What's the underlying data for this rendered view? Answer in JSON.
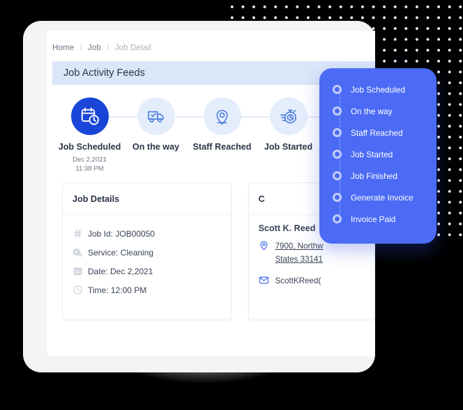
{
  "breadcrumb": {
    "items": [
      "Home",
      "Job",
      "Job Detail"
    ],
    "separator": "/"
  },
  "feed_header": {
    "title": "Job Activity Feeds"
  },
  "stepper": {
    "steps": [
      {
        "label": "Job Scheduled",
        "icon": "calendar-clock-icon",
        "active": true,
        "date": "Dec 2,2021",
        "time": "11:38 PM"
      },
      {
        "label": "On the way",
        "icon": "truck-check-icon",
        "active": false,
        "date": "",
        "time": ""
      },
      {
        "label": "Staff Reached",
        "icon": "map-pin-icon",
        "active": false,
        "date": "",
        "time": ""
      },
      {
        "label": "Job Started",
        "icon": "stopwatch-icon",
        "active": false,
        "date": "",
        "time": ""
      }
    ]
  },
  "job_details": {
    "title": "Job Details",
    "rows": [
      {
        "icon": "hash-icon",
        "text": "Job Id: JOB00050"
      },
      {
        "icon": "gears-icon",
        "text": "Service: Cleaning"
      },
      {
        "icon": "calendar-icon",
        "text": "Date: Dec 2,2021"
      },
      {
        "icon": "clock-icon",
        "text": "Time: 12:00 PM"
      }
    ]
  },
  "customer_details": {
    "title": "C",
    "name": "Scott K. Reed",
    "address_line1": "7900, Northw",
    "address_line2": "States 33141",
    "email": "ScottKReed("
  },
  "dropdown": {
    "items": [
      "Job Scheduled",
      "On the way",
      "Staff Reached",
      "Job Started",
      "Job Finished",
      "Generate Invoice",
      "Invoice Paid"
    ]
  },
  "colors": {
    "accent_blue": "#1a46d8",
    "panel_blue": "#4b6bf5",
    "header_band": "#dbe7f8",
    "step_idle": "#e4edfb",
    "background": "#000000"
  }
}
